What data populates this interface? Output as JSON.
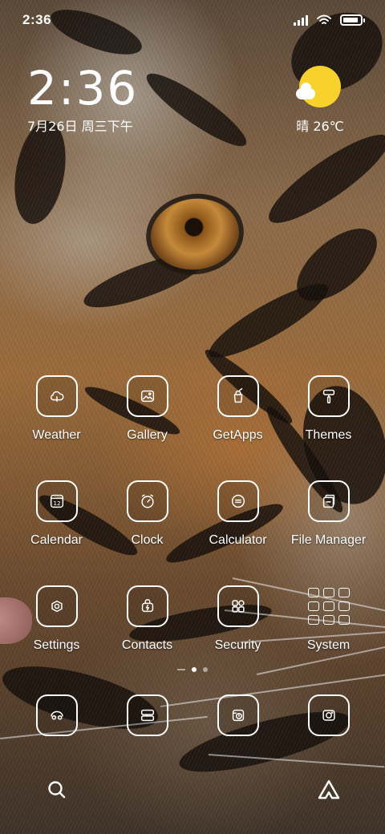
{
  "status_bar": {
    "time": "2:36",
    "battery_level": 0.9
  },
  "clock_widget": {
    "time": "2:36",
    "date": "7月26日 周三下午"
  },
  "weather_widget": {
    "condition_icon": "sun-cloud-icon",
    "text": "晴 26℃"
  },
  "apps": [
    {
      "label": "Weather",
      "icon": "weather-icon"
    },
    {
      "label": "Gallery",
      "icon": "gallery-icon"
    },
    {
      "label": "GetApps",
      "icon": "getapps-icon"
    },
    {
      "label": "Themes",
      "icon": "themes-icon"
    },
    {
      "label": "Calendar",
      "icon": "calendar-icon",
      "icon_text": "12"
    },
    {
      "label": "Clock",
      "icon": "clock-icon"
    },
    {
      "label": "Calculator",
      "icon": "calculator-icon"
    },
    {
      "label": "File Manager",
      "icon": "file-manager-icon"
    },
    {
      "label": "Settings",
      "icon": "settings-icon"
    },
    {
      "label": "Contacts",
      "icon": "contacts-icon"
    },
    {
      "label": "Security",
      "icon": "security-icon"
    },
    {
      "label": "System",
      "icon": "folder-icon"
    }
  ],
  "page_indicator": {
    "current": 1,
    "pages": 2
  },
  "dock": [
    {
      "icon": "phone-icon"
    },
    {
      "icon": "messages-icon"
    },
    {
      "icon": "browser-icon"
    },
    {
      "icon": "camera-icon"
    }
  ],
  "bottom_bar": {
    "left_icon": "search-icon",
    "right_icon": "assistant-icon"
  },
  "colors": {
    "icon_stroke": "#ffffff",
    "sun": "#f7d22a"
  }
}
